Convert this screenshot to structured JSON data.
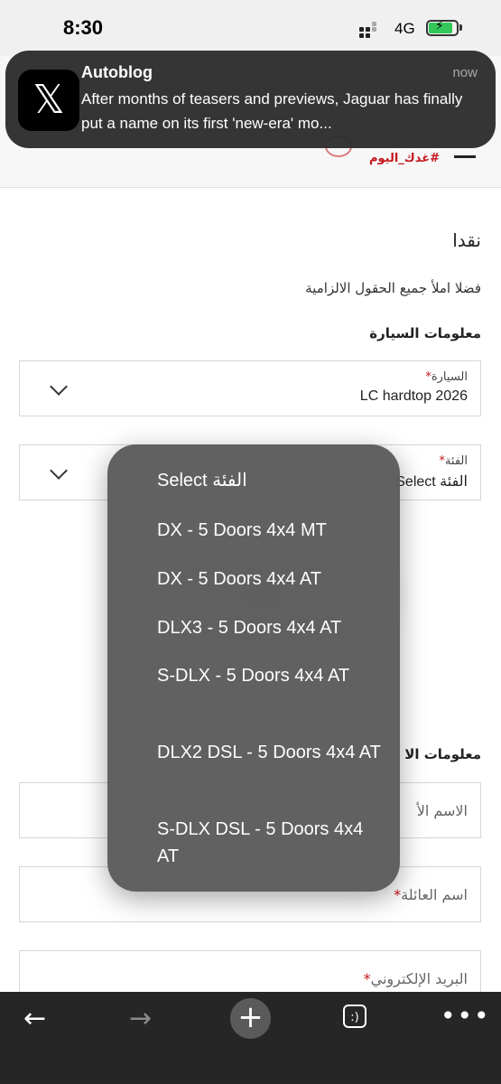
{
  "status_bar": {
    "time": "8:30",
    "network": "4G"
  },
  "notification": {
    "app": "Autoblog",
    "time": "now",
    "body": "After months of teasers and previews, Jaguar has finally put a name on its first 'new-era' mo...",
    "icon": "x-logo-icon"
  },
  "header": {
    "hashtag": "#غدك_اليوم"
  },
  "page": {
    "title": "نقدا",
    "instruction": "فضلا املأ جميع الحقول الالزامية",
    "car_section": "معلومات السيارة",
    "contact_section": "معلومات الا"
  },
  "form": {
    "car": {
      "label": "السيارة",
      "value": "LC hardtop 2026"
    },
    "grade": {
      "label": "الفئة",
      "value": "Select الفئة"
    },
    "first_name": {
      "label": "الاسم الأ"
    },
    "last_name": {
      "label": "اسم العائلة"
    },
    "email": {
      "label": "البريد الإلكتروني"
    },
    "required_mark": "*"
  },
  "dropdown": {
    "selected": "Select الفئة",
    "options": [
      "DX - 5 Doors 4x4 MT",
      "DX - 5 Doors 4x4 AT",
      "DLX3 - 5 Doors 4x4 AT",
      "S-DLX - 5 Doors 4x4 AT",
      "DLX2 DSL - 5 Doors 4x4 AT",
      "S-DLX DSL - 5 Doors 4x4 AT"
    ]
  },
  "toolbar": {
    "tabs_label": ":)"
  }
}
